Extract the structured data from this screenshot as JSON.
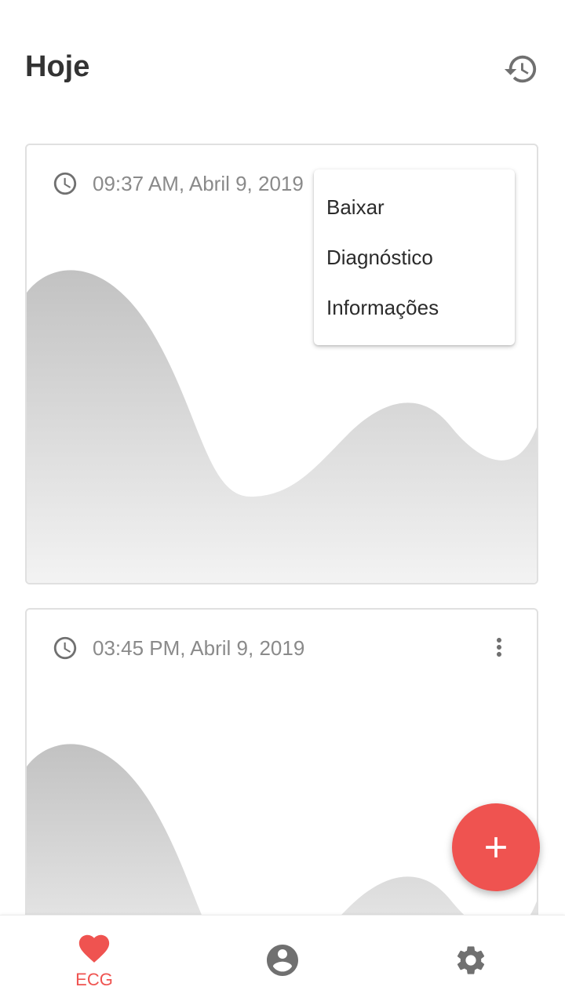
{
  "header": {
    "title": "Hoje",
    "history_icon": "history-icon"
  },
  "cards": [
    {
      "time": "09:37 AM, Abril 9, 2019",
      "icon": "clock-icon"
    },
    {
      "time": "03:45 PM, Abril 9, 2019",
      "icon": "clock-icon",
      "menu_icon": "more-vertical-icon"
    }
  ],
  "menu": {
    "items": [
      "Baixar",
      "Diagnóstico",
      "Informações"
    ]
  },
  "fab": {
    "icon": "plus-icon"
  },
  "bottom_nav": {
    "items": [
      {
        "label": "ECG",
        "icon": "heart-icon",
        "active": true
      },
      {
        "label": "",
        "icon": "account-icon"
      },
      {
        "label": "",
        "icon": "settings-icon"
      }
    ]
  },
  "colors": {
    "accent": "#ef5350",
    "text_muted": "#8a8a8a",
    "icon_gray": "#707070",
    "wave_top": "#c2c2c2",
    "wave_bottom": "#f3f3f3"
  }
}
